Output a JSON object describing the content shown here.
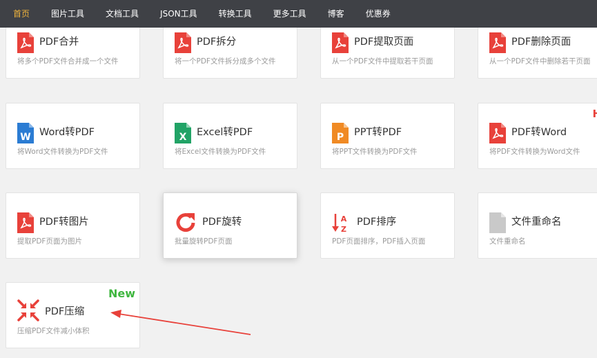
{
  "nav": {
    "items": [
      "首页",
      "图片工具",
      "文档工具",
      "JSON工具",
      "转换工具",
      "更多工具",
      "博客",
      "优惠券"
    ]
  },
  "cards": {
    "pdf_merge": {
      "title": "PDF合并",
      "desc": "将多个PDF文件合并成一个文件"
    },
    "pdf_split": {
      "title": "PDF拆分",
      "desc": "将一个PDF文件拆分成多个文件"
    },
    "pdf_extract": {
      "title": "PDF提取页面",
      "desc": "从一个PDF文件中提取若干页面"
    },
    "pdf_delete": {
      "title": "PDF删除页面",
      "desc": "从一个PDF文件中删除若干页面"
    },
    "word_to_pdf": {
      "title": "Word转PDF",
      "desc": "将Word文件转换为PDF文件"
    },
    "excel_to_pdf": {
      "title": "Excel转PDF",
      "desc": "将Excel文件转换为PDF文件"
    },
    "ppt_to_pdf": {
      "title": "PPT转PDF",
      "desc": "将PPT文件转换为PDF文件"
    },
    "pdf_to_word": {
      "title": "PDF转Word",
      "desc": "将PDF文件转换为Word文件",
      "badge": "H"
    },
    "pdf_to_image": {
      "title": "PDF转图片",
      "desc": "提取PDF页面为图片"
    },
    "pdf_rotate": {
      "title": "PDF旋转",
      "desc": "批量旋转PDF页面"
    },
    "pdf_sort": {
      "title": "PDF排序",
      "desc": "PDF页面排序，PDF插入页面"
    },
    "file_rename": {
      "title": "文件重命名",
      "desc": "文件重命名"
    },
    "pdf_compress": {
      "title": "PDF压缩",
      "desc": "压缩PDF文件减小体积",
      "badge": "New"
    }
  },
  "colors": {
    "nav_bg": "#3f4146",
    "nav_active": "#f0b43c",
    "pdf_red": "#e8413a",
    "word_blue": "#2b7cd3",
    "excel_green": "#21a366",
    "ppt_orange": "#f08a24",
    "new_green": "#3fb63f"
  }
}
